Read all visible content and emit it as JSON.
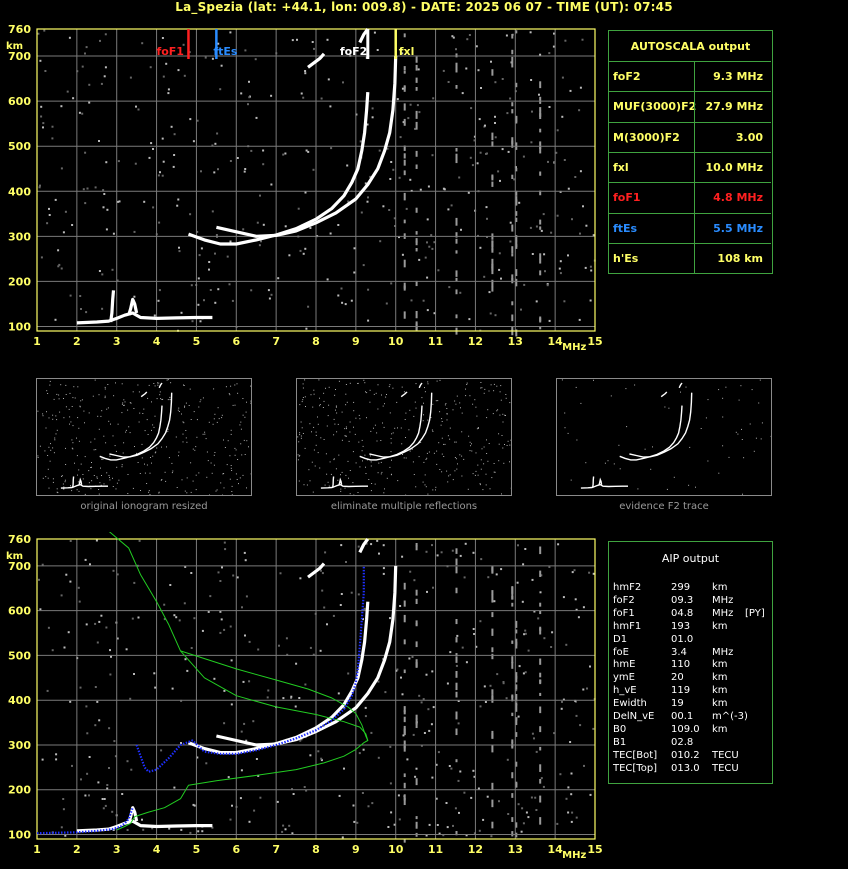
{
  "header": {
    "title": "La_Spezia (lat: +44.1, lon: 009.8) - DATE: 2025 06 07 - TIME (UT): 07:45"
  },
  "colors": {
    "grid": "#7a7a7a",
    "axis": "#ffff66",
    "panel_border": "#3fa33f",
    "foF1": "#ff2020",
    "ftEs": "#2a8cff",
    "label": "#ffff66",
    "value": "#ffff66",
    "profile": "#22cc22",
    "aip_trace": "#1e2fff"
  },
  "chart_data": [
    {
      "type": "scatter",
      "title": "",
      "xlabel": "MHz",
      "ylabel": "km",
      "xlim": [
        1,
        15
      ],
      "ylim": [
        90,
        760
      ],
      "xticks": [
        1,
        2,
        3,
        4,
        5,
        6,
        7,
        8,
        9,
        10,
        11,
        12,
        13,
        14,
        15
      ],
      "yticks": [
        100,
        200,
        300,
        400,
        500,
        600,
        700,
        760
      ],
      "grid": true,
      "markers": [
        {
          "name": "foF1",
          "x": 4.8,
          "color": "#ff2020"
        },
        {
          "name": "ftEs",
          "x": 5.5,
          "color": "#2a8cff"
        },
        {
          "name": "foF2",
          "x": 9.3,
          "color": "#ffffff"
        },
        {
          "name": "fxl",
          "x": 10.0,
          "color": "#ffff66"
        }
      ],
      "series": [
        {
          "role": "E-trace",
          "x": [
            2.0,
            2.5,
            2.8,
            3.0,
            3.2,
            3.4,
            3.6,
            4.0,
            4.5,
            5.0,
            5.4
          ],
          "y": [
            108,
            110,
            112,
            118,
            125,
            130,
            120,
            118,
            119,
            120,
            120
          ]
        },
        {
          "role": "Es-spike",
          "x": [
            2.85,
            2.88,
            2.9,
            2.92
          ],
          "y": [
            110,
            130,
            160,
            180
          ]
        },
        {
          "role": "Es-spike2",
          "x": [
            3.3,
            3.35,
            3.4,
            3.45,
            3.5
          ],
          "y": [
            125,
            140,
            160,
            150,
            130
          ]
        },
        {
          "role": "F-trace-O",
          "x": [
            4.8,
            5.2,
            5.6,
            6.0,
            6.5,
            7.0,
            7.5,
            8.0,
            8.4,
            8.7,
            8.9,
            9.05,
            9.15,
            9.22,
            9.27,
            9.3
          ],
          "y": [
            305,
            292,
            283,
            283,
            292,
            303,
            317,
            338,
            362,
            390,
            420,
            450,
            490,
            530,
            580,
            620
          ]
        },
        {
          "role": "F-trace-X",
          "x": [
            5.5,
            6.0,
            6.5,
            7.0,
            7.5,
            8.0,
            8.5,
            9.0,
            9.3,
            9.55,
            9.72,
            9.85,
            9.93,
            9.98,
            10.0
          ],
          "y": [
            320,
            310,
            300,
            302,
            312,
            330,
            352,
            383,
            415,
            450,
            490,
            530,
            580,
            640,
            700
          ]
        },
        {
          "role": "Top-trace",
          "x": [
            7.8,
            7.95,
            8.1,
            8.2
          ],
          "y": [
            675,
            685,
            695,
            705
          ]
        },
        {
          "role": "Top-trace-F2",
          "x": [
            9.1,
            9.2,
            9.3
          ],
          "y": [
            730,
            748,
            760
          ]
        }
      ]
    },
    {
      "type": "line",
      "title": "",
      "xlabel": "MHz",
      "ylabel": "km",
      "xlim": [
        1,
        15
      ],
      "ylim": [
        90,
        760
      ],
      "xticks": [
        1,
        2,
        3,
        4,
        5,
        6,
        7,
        8,
        9,
        10,
        11,
        12,
        13,
        14,
        15
      ],
      "yticks": [
        100,
        200,
        300,
        400,
        500,
        600,
        700,
        760
      ],
      "grid": true,
      "series": [
        {
          "role": "E-trace",
          "x": [
            2.0,
            2.5,
            2.8,
            3.0,
            3.2,
            3.4,
            3.6,
            4.0,
            4.5,
            5.0,
            5.4
          ],
          "y": [
            108,
            110,
            112,
            118,
            125,
            130,
            120,
            118,
            119,
            120,
            120
          ]
        },
        {
          "role": "Es-spike",
          "x": [
            3.3,
            3.35,
            3.4,
            3.45,
            3.5
          ],
          "y": [
            125,
            140,
            160,
            150,
            130
          ]
        },
        {
          "role": "F-trace-O",
          "x": [
            4.8,
            5.2,
            5.6,
            6.0,
            6.5,
            7.0,
            7.5,
            8.0,
            8.4,
            8.7,
            8.9,
            9.05,
            9.15,
            9.22,
            9.27,
            9.3
          ],
          "y": [
            305,
            292,
            283,
            283,
            292,
            303,
            317,
            338,
            362,
            390,
            420,
            450,
            490,
            530,
            580,
            620
          ]
        },
        {
          "role": "F-trace-X",
          "x": [
            5.5,
            6.0,
            6.5,
            7.0,
            7.5,
            8.0,
            8.5,
            9.0,
            9.3,
            9.55,
            9.72,
            9.85,
            9.93,
            9.98,
            10.0
          ],
          "y": [
            320,
            310,
            300,
            302,
            312,
            330,
            352,
            383,
            415,
            450,
            490,
            530,
            580,
            640,
            700
          ]
        },
        {
          "role": "Top-trace",
          "x": [
            7.8,
            7.95,
            8.1,
            8.2
          ],
          "y": [
            675,
            685,
            695,
            705
          ]
        },
        {
          "role": "Top-trace-F2",
          "x": [
            9.1,
            9.2,
            9.3
          ],
          "y": [
            730,
            748,
            760
          ]
        },
        {
          "role": "profile-green",
          "color": "#22cc22",
          "x": [
            3.0,
            3.2,
            3.35,
            3.45,
            3.8,
            4.2,
            4.6,
            4.8,
            5.5,
            6.5,
            7.5,
            8.2,
            8.7,
            9.0,
            9.2,
            9.3,
            9.25,
            9.1,
            8.7,
            8.0,
            7.0,
            6.0,
            5.2,
            4.6,
            4.3,
            4.0,
            3.6,
            3.3,
            2.5,
            1.5,
            1.0
          ],
          "y": [
            110,
            118,
            125,
            140,
            150,
            160,
            180,
            210,
            220,
            232,
            245,
            260,
            275,
            290,
            305,
            310,
            325,
            340,
            352,
            368,
            385,
            410,
            450,
            510,
            570,
            620,
            680,
            740,
            800,
            900,
            1000
          ]
        },
        {
          "role": "profile-topside",
          "color": "#22cc22",
          "x": [
            4.6,
            6.0,
            7.0,
            7.8,
            8.4,
            8.8,
            9.0,
            9.15,
            9.25,
            9.3
          ],
          "y": [
            510,
            470,
            445,
            425,
            405,
            385,
            370,
            345,
            320,
            310
          ]
        },
        {
          "role": "aip-fit",
          "color": "#1e2fff",
          "x": [
            1.0,
            2.0,
            2.5,
            2.9,
            3.1,
            3.2,
            3.3,
            3.4
          ],
          "y": [
            103,
            105,
            108,
            112,
            118,
            125,
            135,
            160
          ]
        },
        {
          "role": "aip-fit-F",
          "color": "#1e2fff",
          "x": [
            3.5,
            3.7,
            3.8,
            4.0,
            4.3,
            4.6,
            4.9,
            5.2,
            5.6,
            6.0,
            6.5,
            7.0,
            7.5,
            8.0,
            8.4,
            8.7,
            8.9,
            9.0,
            9.05,
            9.1,
            9.15,
            9.2,
            9.2
          ],
          "y": [
            300,
            250,
            240,
            245,
            270,
            300,
            310,
            285,
            280,
            280,
            288,
            300,
            315,
            333,
            355,
            380,
            410,
            440,
            470,
            520,
            580,
            640,
            700
          ]
        }
      ]
    }
  ],
  "autoscala": {
    "title": "AUTOSCALA output",
    "rows": [
      {
        "name": "foF2",
        "value": "9.3 MHz",
        "name_color": "#ffff66",
        "value_color": "#ffff66"
      },
      {
        "name": "MUF(3000)F2",
        "value": "27.9 MHz",
        "name_color": "#ffff66",
        "value_color": "#ffff66"
      },
      {
        "name": "M(3000)F2",
        "value": "3.00",
        "name_color": "#ffff66",
        "value_color": "#ffff66"
      },
      {
        "name": "fxl",
        "value": "10.0 MHz",
        "name_color": "#ffff66",
        "value_color": "#ffff66"
      },
      {
        "name": "foF1",
        "value": "4.8 MHz",
        "name_color": "#ff2020",
        "value_color": "#ff2020"
      },
      {
        "name": "ftEs",
        "value": "5.5 MHz",
        "name_color": "#2a8cff",
        "value_color": "#2a8cff"
      },
      {
        "name": "h'Es",
        "value": "108     km",
        "name_color": "#ffff66",
        "value_color": "#ffff66"
      }
    ]
  },
  "aip": {
    "title": "AIP output",
    "rows": [
      {
        "name": "hmF2",
        "value": "299",
        "unit": "km",
        "extra": ""
      },
      {
        "name": "foF2",
        "value": "09.3",
        "unit": "MHz",
        "extra": ""
      },
      {
        "name": "foF1",
        "value": "04.8",
        "unit": "MHz",
        "extra": "[PY]"
      },
      {
        "name": "hmF1",
        "value": "193",
        "unit": "km",
        "extra": ""
      },
      {
        "name": "D1",
        "value": "01.0",
        "unit": "",
        "extra": ""
      },
      {
        "name": "foE",
        "value": "3.4",
        "unit": "MHz",
        "extra": ""
      },
      {
        "name": "hmE",
        "value": "110",
        "unit": "km",
        "extra": ""
      },
      {
        "name": "ymE",
        "value": "20",
        "unit": "km",
        "extra": ""
      },
      {
        "name": "h_vE",
        "value": "119",
        "unit": "km",
        "extra": ""
      },
      {
        "name": "Ewidth",
        "value": "19",
        "unit": "km",
        "extra": ""
      },
      {
        "name": "DelN_vE",
        "value": "00.1",
        "unit": "m^(-3)",
        "extra": ""
      },
      {
        "name": "B0",
        "value": "109.0",
        "unit": "km",
        "extra": ""
      },
      {
        "name": "B1",
        "value": "02.8",
        "unit": "",
        "extra": ""
      },
      {
        "name": "TEC[Bot]",
        "value": "010.2",
        "unit": "TECU",
        "extra": ""
      },
      {
        "name": "TEC[Top]",
        "value": "013.0",
        "unit": "TECU",
        "extra": ""
      }
    ]
  },
  "thumbnails": [
    {
      "caption": "original ionogram resized"
    },
    {
      "caption": "eliminate multiple reflections"
    },
    {
      "caption": "evidence F2 trace"
    }
  ]
}
